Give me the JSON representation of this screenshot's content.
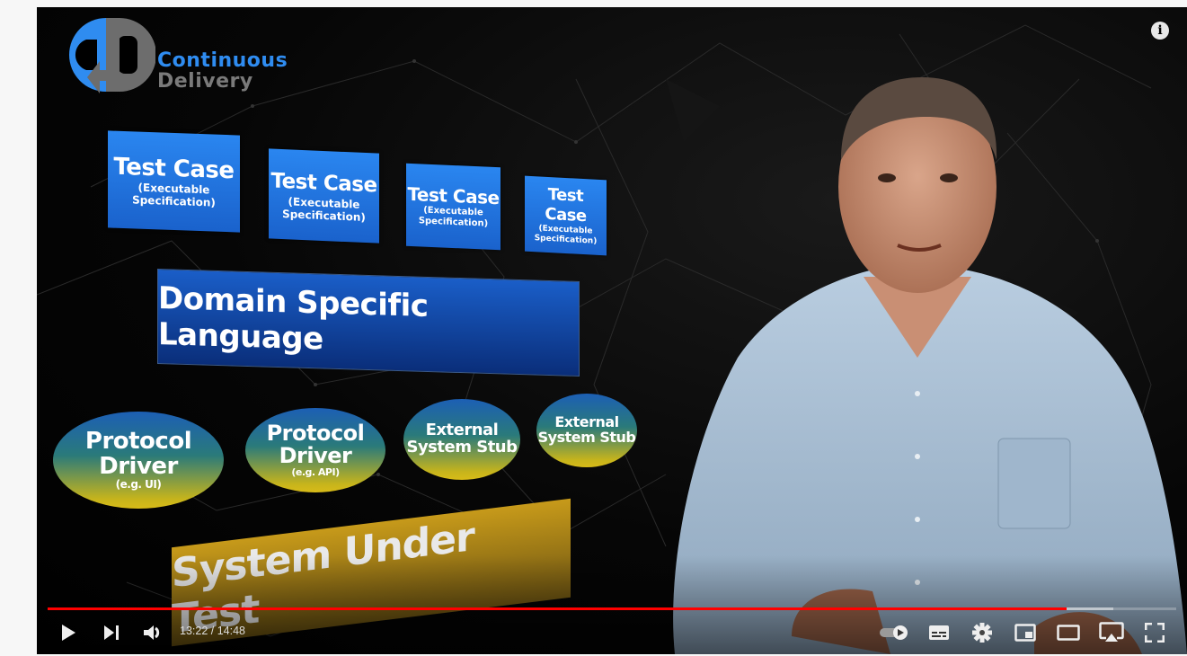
{
  "player": {
    "logo": {
      "line1": "Continuous",
      "line2": "Delivery",
      "brand_blue": "#2f8cf0",
      "brand_gray": "#7a7a7a"
    },
    "info_button": {
      "icon": "info-icon",
      "glyph": "i"
    },
    "slide": {
      "test_cases": [
        {
          "title": "Test Case",
          "subtitle_line1": "(Executable",
          "subtitle_line2": "Specification)"
        },
        {
          "title": "Test Case",
          "subtitle_line1": "(Executable",
          "subtitle_line2": "Specification)"
        },
        {
          "title": "Test Case",
          "subtitle_line1": "(Executable",
          "subtitle_line2": "Specification)"
        },
        {
          "title": "Test Case",
          "subtitle_line1": "(Executable",
          "subtitle_line2": "Specification)"
        }
      ],
      "dsl_label": "Domain Specific Language",
      "components": [
        {
          "line1": "Protocol",
          "line2": "Driver",
          "note": "(e.g. UI)"
        },
        {
          "line1": "Protocol",
          "line2": "Driver",
          "note": "(e.g. API)"
        },
        {
          "line1": "External",
          "line2": "System Stub",
          "note": ""
        },
        {
          "line1": "External",
          "line2": "System Stub",
          "note": ""
        }
      ],
      "sut_label": "System Under Test"
    },
    "controls": {
      "current_time": "13:22",
      "duration": "14:48",
      "time_display": "13:22 / 14:48",
      "played_fraction": 0.903,
      "buffered_fraction": 0.944,
      "progress_color": "#ff0000",
      "buttons_left": [
        {
          "name": "play-button",
          "icon": "play-icon"
        },
        {
          "name": "next-button",
          "icon": "skip-next-icon"
        },
        {
          "name": "mute-button",
          "icon": "volume-icon"
        }
      ],
      "buttons_right": [
        {
          "name": "autoplay-toggle",
          "icon": "autoplay-toggle-icon",
          "state": "on"
        },
        {
          "name": "subtitles-button",
          "icon": "subtitles-icon"
        },
        {
          "name": "settings-button",
          "icon": "gear-icon"
        },
        {
          "name": "miniplayer-button",
          "icon": "miniplayer-icon"
        },
        {
          "name": "theater-mode-button",
          "icon": "theater-icon"
        },
        {
          "name": "airplay-button",
          "icon": "airplay-icon"
        },
        {
          "name": "fullscreen-button",
          "icon": "fullscreen-icon"
        }
      ]
    }
  }
}
